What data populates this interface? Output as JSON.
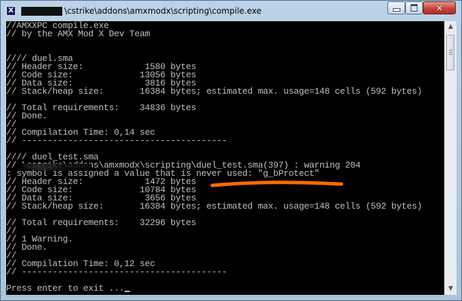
{
  "window": {
    "title": "\\cstrike\\addons\\amxmodx\\scripting\\compile.exe",
    "icon_glyph": "X",
    "close_glyph": "✕"
  },
  "console": {
    "lines": [
      "//AMXXPC compile.exe",
      "// by the AMX Mod X Dev Team",
      "",
      "",
      "//// duel.sma",
      "// Header size:            1580 bytes",
      "// Code size:             13056 bytes",
      "// Data size:              3816 bytes",
      "// Stack/heap size:       16384 bytes; estimated max. usage=148 cells (592 bytes)",
      "",
      "// Total requirements:    34836 bytes",
      "// Done.",
      "//",
      "// Compilation Time: 0,14 sec",
      "// ----------------------------------------",
      "",
      "//// duel_test.sma",
      "// \\cstrike\\addons\\amxmodx\\scripting\\duel_test.sma(397) : warning 204",
      ": symbol is assigned a value that is never used: \"g_bProtect\"",
      "// Header size:            1472 bytes",
      "// Code size:             10784 bytes",
      "// Data size:              3656 bytes",
      "// Stack/heap size:       16384 bytes; estimated max. usage=148 cells (592 bytes)",
      "",
      "// Total requirements:    32296 bytes",
      "//",
      "// 1 Warning.",
      "// Done.",
      "//",
      "// Compilation Time: 0,12 sec",
      "// ----------------------------------------",
      "",
      "Press enter to exit ..."
    ]
  },
  "colors": {
    "console_bg": "#000000",
    "console_text": "#c0c0c0",
    "highlight_stroke": "#ff6a00"
  },
  "icons": [
    "cmd-app-icon",
    "minimize-icon",
    "maximize-icon",
    "close-icon",
    "scroll-up-icon",
    "scroll-down-icon"
  ]
}
